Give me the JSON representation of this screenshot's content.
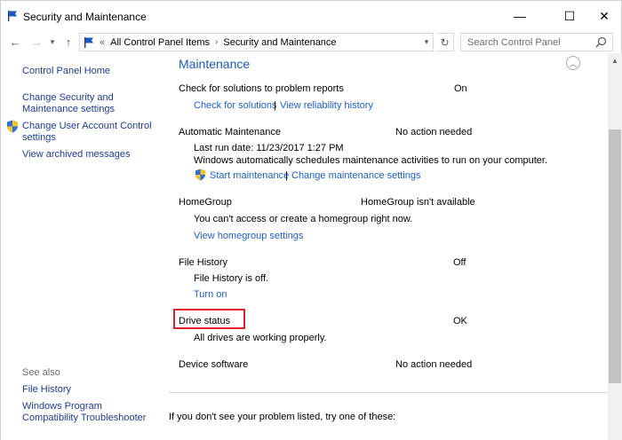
{
  "window": {
    "title": "Security and Maintenance",
    "minimize": "—",
    "maximize": "☐",
    "close": "✕"
  },
  "address": {
    "recent_marker": "«",
    "crumbs": [
      "All Control Panel Items",
      "Security and Maintenance"
    ],
    "search_placeholder": "Search Control Panel"
  },
  "sidebar": {
    "home": "Control Panel Home",
    "change_security": "Change Security and Maintenance settings",
    "change_security_line1": "Change Security and",
    "change_security_line2": "Maintenance settings",
    "uac_line1": "Change User Account Control",
    "uac_line2": "settings",
    "archived": "View archived messages",
    "see_also": "See also",
    "file_history": "File History",
    "compat_line1": "Windows Program",
    "compat_line2": "Compatibility Troubleshooter"
  },
  "maintenance": {
    "title": "Maintenance",
    "items": {
      "check_solutions": {
        "name": "Check for solutions to problem reports",
        "status": "On",
        "links": [
          "Check for solutions",
          "View reliability history"
        ]
      },
      "auto_maintenance": {
        "name": "Automatic Maintenance",
        "status": "No action needed",
        "last_run": "Last run date: 11/23/2017 1:27 PM",
        "desc": "Windows automatically schedules maintenance activities to run on your computer.",
        "links": [
          "Start maintenance",
          "Change maintenance settings"
        ]
      },
      "homegroup": {
        "name": "HomeGroup",
        "status": "HomeGroup isn't available",
        "desc": "You can't access or create a homegroup right now.",
        "link": "View homegroup settings"
      },
      "file_history": {
        "name": "File History",
        "status": "Off",
        "desc": "File History is off.",
        "link": "Turn on"
      },
      "drive_status": {
        "name": "Drive status",
        "status": "OK",
        "desc": "All drives are working properly."
      },
      "device_software": {
        "name": "Device software",
        "status": "No action needed"
      }
    },
    "separator": "|",
    "footer": "If you don't see your problem listed, try one of these:"
  },
  "colors": {
    "link": "#1c60c8",
    "section_title": "#1e5ab6",
    "highlight": "#e0202a"
  }
}
